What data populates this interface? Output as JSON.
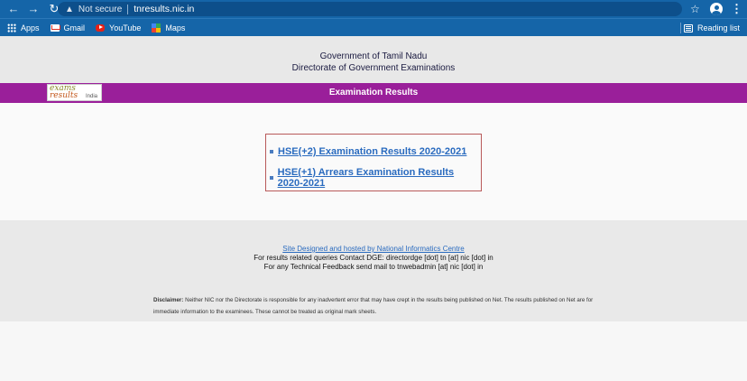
{
  "browser": {
    "security_label": "Not secure",
    "url": "tnresults.nic.in",
    "bookmarks": [
      {
        "label": "Apps",
        "icon": "apps-icon"
      },
      {
        "label": "Gmail",
        "icon": "gmail-icon"
      },
      {
        "label": "YouTube",
        "icon": "youtube-icon"
      },
      {
        "label": "Maps",
        "icon": "maps-icon"
      }
    ],
    "reading_list": "Reading list"
  },
  "header": {
    "line1": "Government of Tamil Nadu",
    "line2": "Directorate of Government Examinations"
  },
  "banner": {
    "title": "Examination Results",
    "logo": {
      "word1": "exams",
      "word2": "results",
      "word3": "India"
    }
  },
  "results": [
    {
      "label": "HSE(+2) Examination Results 2020-2021"
    },
    {
      "label": "HSE(+1) Arrears Examination Results 2020-2021"
    }
  ],
  "footer": {
    "credit_link": "Site Designed and hosted by National Informatics Centre",
    "contact_line": "For results related queries Contact DGE:  directordge [dot] tn [at] nic [dot] in",
    "feedback_line": "For any Technical Feedback send mail to tnwebadmin [at] nic [dot] in",
    "disclaimer_label": "Disclaimer:",
    "disclaimer_text": " Neither NIC nor the Directorate is responsible for any inadvertent error that may have crept in the results being published on Net. The results published on Net are for immediate information to the examinees. These cannot be treated as original mark sheets."
  },
  "colors": {
    "chrome": "#1565a8",
    "banner": "#9a1f9a",
    "link": "#2a6bbf",
    "box_border": "#b85a5a"
  }
}
